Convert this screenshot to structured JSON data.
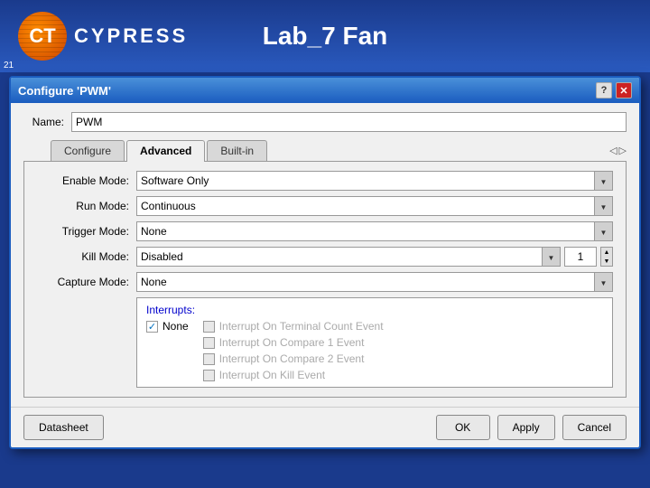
{
  "header": {
    "title": "Lab_7 Fan",
    "brand": "CYPRESS",
    "slide_number": "21"
  },
  "dialog": {
    "title": "Configure 'PWM'",
    "name_label": "Name:",
    "name_value": "PWM",
    "help_btn": "?",
    "close_btn": "✕",
    "tabs": [
      {
        "label": "Configure",
        "active": false
      },
      {
        "label": "Advanced",
        "active": true
      },
      {
        "label": "Built-in",
        "active": false
      }
    ],
    "fields": [
      {
        "label": "Enable Mode:",
        "value": "Software Only"
      },
      {
        "label": "Run Mode:",
        "value": "Continuous"
      },
      {
        "label": "Trigger Mode:",
        "value": "None"
      },
      {
        "label": "Kill Mode:",
        "value": "Disabled",
        "extra_value": "1"
      },
      {
        "label": "Capture Mode:",
        "value": "None"
      }
    ],
    "interrupts": {
      "title": "Interrupts:",
      "left": [
        {
          "label": "None",
          "checked": true
        }
      ],
      "right": [
        {
          "label": "Interrupt On Terminal Count Event",
          "checked": false,
          "disabled": true
        },
        {
          "label": "Interrupt On Compare 1 Event",
          "checked": false,
          "disabled": true
        },
        {
          "label": "Interrupt On Compare 2 Event",
          "checked": false,
          "disabled": true
        },
        {
          "label": "Interrupt On Kill Event",
          "checked": false,
          "disabled": true
        }
      ]
    },
    "buttons": {
      "datasheet": "Datasheet",
      "ok": "OK",
      "apply": "Apply",
      "cancel": "Cancel"
    }
  }
}
